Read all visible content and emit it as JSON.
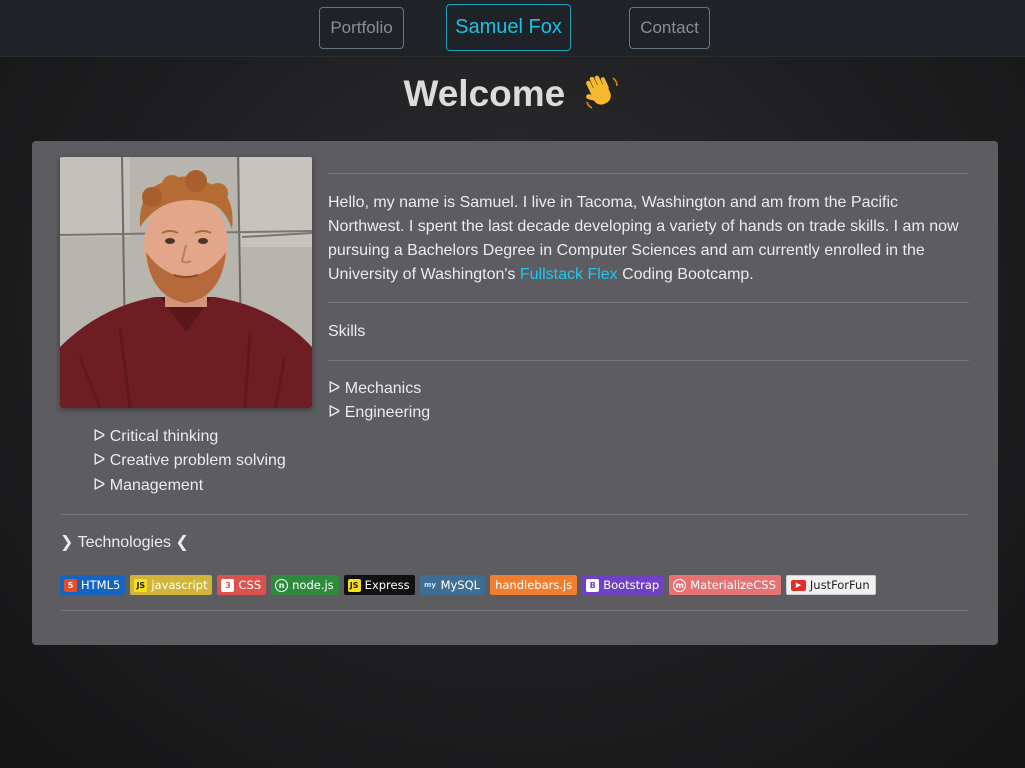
{
  "nav": {
    "portfolio": "Portfolio",
    "brand": "Samuel Fox",
    "contact": "Contact"
  },
  "header": {
    "title": "Welcome"
  },
  "bio": {
    "text_before": "Hello, my name is Samuel. I live in Tacoma, Washington and am from the Pacific Northwest. I spent the last decade developing a variety of hands on trade skills. I am now pursuing a Bachelors Degree in Computer Sciences and am currently enrolled in the University of Washington's ",
    "link": "Fullstack Flex",
    "text_after": " Coding Bootcamp."
  },
  "skills": {
    "heading": "Skills",
    "items": [
      "ᐅ Mechanics",
      "ᐅ Engineering",
      "ᐅ Critical thinking",
      "ᐅ Creative problem solving",
      "ᐅ Management"
    ]
  },
  "technologies": {
    "heading": "❯ Technologies ❮",
    "badges": [
      {
        "label": "HTML5",
        "color": "#1565c0",
        "icon": "html5-icon"
      },
      {
        "label": "javascript",
        "color": "#d1b53a",
        "icon": "javascript-icon"
      },
      {
        "label": "CSS",
        "color": "#d9534f",
        "icon": "css3-icon"
      },
      {
        "label": "node.js",
        "color": "#2e8b3e",
        "icon": "nodejs-icon"
      },
      {
        "label": "Express",
        "color": "#111111",
        "icon": "express-icon"
      },
      {
        "label": "MySQL",
        "color": "#3e6e93",
        "icon": "mysql-icon"
      },
      {
        "label": "handlebars.js",
        "color": "#f07e2e",
        "icon": "handlebars-icon"
      },
      {
        "label": "Bootstrap",
        "color": "#6f42c1",
        "icon": "bootstrap-icon"
      },
      {
        "label": "MaterializeCSS",
        "color": "#e57373",
        "icon": "materialize-icon"
      },
      {
        "label": "JustForFun",
        "color": "#f0f0f0",
        "icon": "youtube-icon"
      }
    ]
  }
}
